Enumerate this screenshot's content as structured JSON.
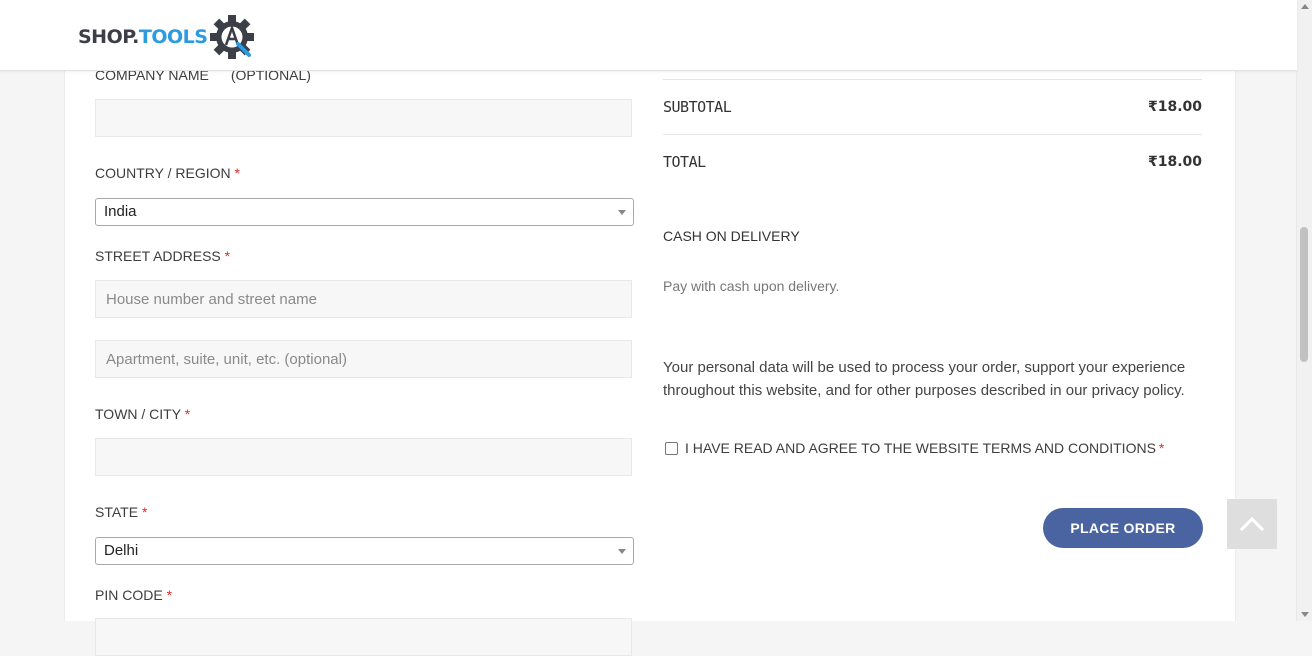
{
  "brand": {
    "part1": "SHOP.",
    "part2": "TOOLS",
    "accent": "#2d9be0",
    "dark": "#3c3f48"
  },
  "billing": {
    "company_label": "COMPANY NAME",
    "company_optional": "(OPTIONAL)",
    "country_label": "COUNTRY / REGION",
    "country_value": "India",
    "street_label": "STREET ADDRESS",
    "street_placeholder": "House number and street name",
    "apartment_placeholder": "Apartment, suite, unit, etc. (optional)",
    "town_label": "TOWN / CITY",
    "state_label": "STATE",
    "state_value": "Delhi",
    "pin_label": "PIN CODE",
    "required_mark": "*"
  },
  "order": {
    "subtotal_label": "SUBTOTAL",
    "subtotal_value": "₹18.00",
    "total_label": "TOTAL",
    "total_value": "₹18.00",
    "payment_method": "CASH ON DELIVERY",
    "payment_desc": "Pay with cash upon delivery.",
    "privacy_text": "Your personal data will be used to process your order, support your experience throughout this website, and for other purposes described in our",
    "privacy_link": "privacy policy.",
    "terms_label": "I HAVE READ AND AGREE TO THE WEBSITE TERMS AND CONDITIONS",
    "place_order_label": "PLACE ORDER",
    "button_color": "#4a64a2"
  },
  "icons": {
    "back_to_top": "chevron-up-icon",
    "logo": "gear-icon"
  }
}
